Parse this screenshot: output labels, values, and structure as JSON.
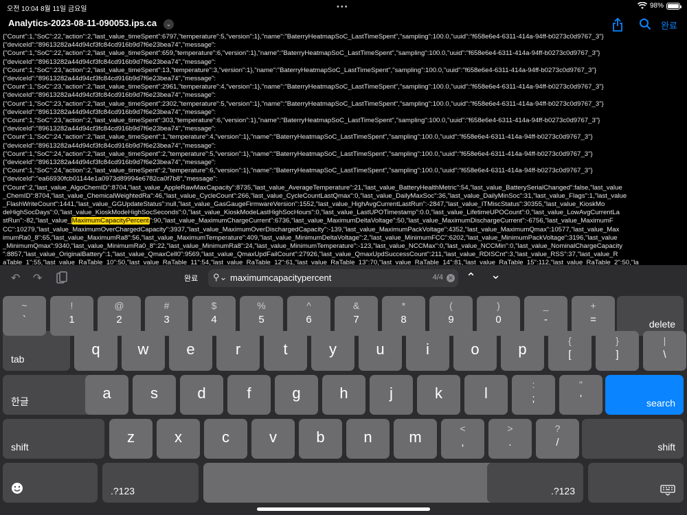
{
  "status": {
    "time_date": "오전 10:04   8월 11일 금요일",
    "battery": "98%"
  },
  "titlebar": {
    "title": "Analytics-2023-08-11-090053.ips.ca",
    "done": "완료"
  },
  "log_lines": [
    "{\"Count\":1,\"SoC\":22,\"action\":2,\"last_value_timeSpent\":6797,\"temperature\":5,\"version\":1},\"name\":\"BaterryHeatmapSoC_LastTimeSpent\",\"sampling\":100.0,\"uuid\":\"f658e6e4-6311-414a-94ff-b0273c0d9767_3\"}",
    "{\"deviceId\":\"89613282a44d94cf3fc84cd916b9d7f6e23bea74\",\"message\":",
    "{\"Count\":1,\"SoC\":22,\"action\":2,\"last_value_timeSpent\":659,\"temperature\":6,\"version\":1},\"name\":\"BaterryHeatmapSoC_LastTimeSpent\",\"sampling\":100.0,\"uuid\":\"f658e6e4-6311-414a-94ff-b0273c0d9767_3\"}",
    "{\"deviceId\":\"89613282a44d94cf3fc84cd916b9d7f6e23bea74\",\"message\":",
    "{\"Count\":1,\"SoC\":23,\"action\":2,\"last_value_timeSpent\":13,\"temperature\":3,\"version\":1},\"name\":\"BaterryHeatmapSoC_LastTimeSpent\",\"sampling\":100.0,\"uuid\":\"f658e6e4-6311-414a-94ff-b0273c0d9767_3\"}",
    "{\"deviceId\":\"89613282a44d94cf3fc84cd916b9d7f6e23bea74\",\"message\":",
    "{\"Count\":1,\"SoC\":23,\"action\":2,\"last_value_timeSpent\":2961,\"temperature\":4,\"version\":1},\"name\":\"BaterryHeatmapSoC_LastTimeSpent\",\"sampling\":100.0,\"uuid\":\"f658e6e4-6311-414a-94ff-b0273c0d9767_3\"}",
    "{\"deviceId\":\"89613282a44d94cf3fc84cd916b9d7f6e23bea74\",\"message\":",
    "{\"Count\":1,\"SoC\":23,\"action\":2,\"last_value_timeSpent\":2302,\"temperature\":5,\"version\":1},\"name\":\"BaterryHeatmapSoC_LastTimeSpent\",\"sampling\":100.0,\"uuid\":\"f658e6e4-6311-414a-94ff-b0273c0d9767_3\"}",
    "{\"deviceId\":\"89613282a44d94cf3fc84cd916b9d7f6e23bea74\",\"message\":",
    "{\"Count\":1,\"SoC\":23,\"action\":2,\"last_value_timeSpent\":303,\"temperature\":6,\"version\":1},\"name\":\"BaterryHeatmapSoC_LastTimeSpent\",\"sampling\":100.0,\"uuid\":\"f658e6e4-6311-414a-94ff-b0273c0d9767_3\"}",
    "{\"deviceId\":\"89613282a44d94cf3fc84cd916b9d7f6e23bea74\",\"message\":",
    "{\"Count\":1,\"SoC\":24,\"action\":2,\"last_value_timeSpent\":1,\"temperature\":4,\"version\":1},\"name\":\"BaterryHeatmapSoC_LastTimeSpent\",\"sampling\":100.0,\"uuid\":\"f658e6e4-6311-414a-94ff-b0273c0d9767_3\"}",
    "{\"deviceId\":\"89613282a44d94cf3fc84cd916b9d7f6e23bea74\",\"message\":",
    "{\"Count\":1,\"SoC\":24,\"action\":2,\"last_value_timeSpent\":2,\"temperature\":5,\"version\":1},\"name\":\"BaterryHeatmapSoC_LastTimeSpent\",\"sampling\":100.0,\"uuid\":\"f658e6e4-6311-414a-94ff-b0273c0d9767_3\"}",
    "{\"deviceId\":\"89613282a44d94cf3fc84cd916b9d7f6e23bea74\",\"message\":",
    "{\"Count\":1,\"SoC\":24,\"action\":2,\"last_value_timeSpent\":2,\"temperature\":6,\"version\":1},\"name\":\"BaterryHeatmapSoC_LastTimeSpent\",\"sampling\":100.0,\"uuid\":\"f658e6e4-6311-414a-94ff-b0273c0d9767_3\"}",
    "{\"deviceId\":\"ea66930fcb01144e1a0973d89994e6782ca0f7b8\",\"message\":",
    "{\"Count\":2,\"last_value_AlgoChemID\":8704,\"last_value_AppleRawMaxCapacity\":8735,\"last_value_AverageTemperature\":21,\"last_value_BatteryHealthMetric\":54,\"last_value_BatterySerialChanged\":false,\"last_value",
    "_ChemID\":8704,\"last_value_ChemicalWeightedRa\":46,\"last_value_CycleCount\":266,\"last_value_CycleCountLastQmax\":0,\"last_value_DailyMaxSoc\":36,\"last_value_DailyMinSoc\":31,\"last_value_Flags\":1,\"last_value",
    "_FlashWriteCount\":1441,\"last_value_GGUpdateStatus\":null,\"last_value_GasGaugeFirmwareVersion\":1552,\"last_value_HighAvgCurrentLastRun\":-2847,\"last_value_ITMiscStatus\":30355,\"last_value_KioskMo",
    "deHighSocDays\":0,\"last_value_KioskModeHighSocSeconds\":0,\"last_value_KioskModeLastHighSocHours\":0,\"last_value_LastUPOTimestamp\":0.0,\"last_value_LifetimeUPOCount\":0,\"last_value_LowAvgCurrentLa",
    "stRun\":-82,\"last_value_##HL##\":90,\"last_value_MaximumChargeCurrent\":6736,\"last_value_MaximumDeltaVoltage\":50,\"last_value_MaximumDischargeCurrent\":-6756,\"last_value_MaximumF",
    "CC\":10279,\"last_value_MaximumOverChargedCapacity\":3937,\"last_value_MaximumOverDischargedCapacity\":-139,\"last_value_MaximumPackVoltage\":4352,\"last_value_MaximumQmax\":10577,\"last_value_Max",
    "imumRa0_8\":65,\"last_value_MaximumRa8\":56,\"last_value_MaximumTemperature\":409,\"last_value_MinimumDeltaVoltage\":2,\"last_value_MinimumFCC\":6202,\"last_value_MinimumPackVoltage\":3196,\"last_value",
    "_MinimumQmax\":9340,\"last_value_MinimumRa0_8\":22,\"last_value_MinimumRa8\":24,\"last_value_MinimumTemperature\":-123,\"last_value_NCCMax\":0,\"last_value_NCCMin\":0,\"last_value_NominalChargeCapacity",
    "\":8857,\"last_value_OriginalBattery\":1,\"last_value_QmaxCell0\":9569,\"last_value_QmaxUpdFailCount\":27926,\"last_value_QmaxUpdSuccessCount\":211,\"last_value_RDISCnt\":3,\"last_value_RSS\":37,\"last_value_R",
    "aTable_1\":55,\"last_value_RaTable_10\":50,\"last_value_RaTable_11\":54,\"last_value_RaTable_12\":61,\"last_value_RaTable_13\":70,\"last_value_RaTable_14\":81,\"last_value_RaTable_15\":112,\"last_value_RaTable_2\":50,\"la"
  ],
  "log_highlight": "MaximumCapacityPercent",
  "findbar": {
    "done": "완료",
    "query": "maximumcapacitypercent",
    "count": "4/4"
  },
  "keyboard": {
    "row1": [
      {
        "top": "~",
        "bot": "`"
      },
      {
        "top": "!",
        "bot": "1"
      },
      {
        "top": "@",
        "bot": "2"
      },
      {
        "top": "#",
        "bot": "3"
      },
      {
        "top": "$",
        "bot": "4"
      },
      {
        "top": "%",
        "bot": "5"
      },
      {
        "top": "^",
        "bot": "6"
      },
      {
        "top": "&",
        "bot": "7"
      },
      {
        "top": "*",
        "bot": "8"
      },
      {
        "top": "(",
        "bot": "9"
      },
      {
        "top": ")",
        "bot": "0"
      },
      {
        "top": "_",
        "bot": "-"
      },
      {
        "top": "+",
        "bot": "="
      }
    ],
    "delete": "delete",
    "tab": "tab",
    "row2": [
      "q",
      "w",
      "e",
      "r",
      "t",
      "y",
      "u",
      "i",
      "o",
      "p"
    ],
    "row2_sym": [
      {
        "top": "{",
        "bot": "["
      },
      {
        "top": "}",
        "bot": "]"
      },
      {
        "top": "|",
        "bot": "\\"
      }
    ],
    "lang": "한글",
    "row3": [
      "a",
      "s",
      "d",
      "f",
      "g",
      "h",
      "j",
      "k",
      "l"
    ],
    "row3_sym": [
      {
        "top": ":",
        "bot": ";"
      },
      {
        "top": "\"",
        "bot": "'"
      }
    ],
    "search": "search",
    "shift": "shift",
    "row4": [
      "z",
      "x",
      "c",
      "v",
      "b",
      "n",
      "m"
    ],
    "row4_sym": [
      {
        "top": "<",
        "bot": ","
      },
      {
        "top": ">",
        "bot": "."
      },
      {
        "top": "?",
        "bot": "/"
      }
    ],
    "numsym": ".?123"
  }
}
